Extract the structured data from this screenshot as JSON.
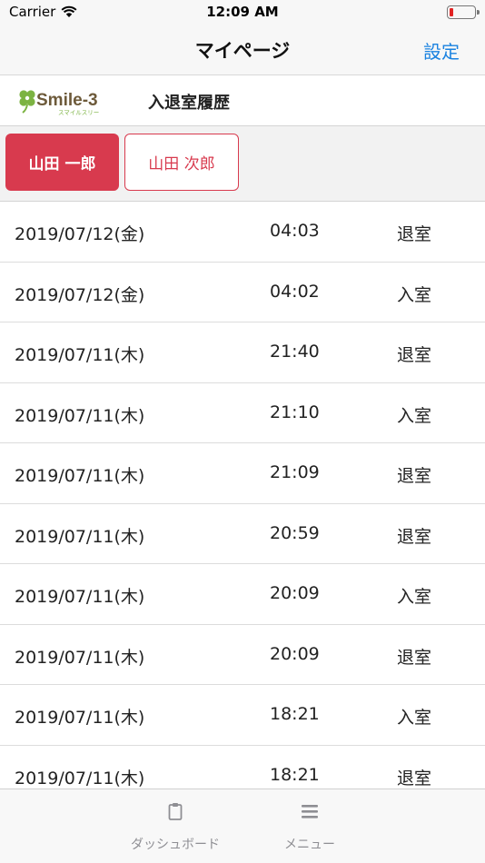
{
  "status_bar": {
    "carrier": "Carrier",
    "time": "12:09 AM",
    "battery_level": 0.15
  },
  "nav": {
    "title": "マイページ",
    "settings_label": "設定"
  },
  "section": {
    "logo_text": "Smile-3",
    "logo_subtext": "スマイルスリー",
    "title": "入退室履歴"
  },
  "tabs": [
    {
      "label": "山田 一郎",
      "active": true
    },
    {
      "label": "山田 次郎",
      "active": false
    }
  ],
  "records": [
    {
      "date": "2019/07/12(金)",
      "time": "04:03",
      "type": "退室"
    },
    {
      "date": "2019/07/12(金)",
      "time": "04:02",
      "type": "入室"
    },
    {
      "date": "2019/07/11(木)",
      "time": "21:40",
      "type": "退室"
    },
    {
      "date": "2019/07/11(木)",
      "time": "21:10",
      "type": "入室"
    },
    {
      "date": "2019/07/11(木)",
      "time": "21:09",
      "type": "退室"
    },
    {
      "date": "2019/07/11(木)",
      "time": "20:59",
      "type": "退室"
    },
    {
      "date": "2019/07/11(木)",
      "time": "20:09",
      "type": "入室"
    },
    {
      "date": "2019/07/11(木)",
      "time": "20:09",
      "type": "退室"
    },
    {
      "date": "2019/07/11(木)",
      "time": "18:21",
      "type": "入室"
    },
    {
      "date": "2019/07/11(木)",
      "time": "18:21",
      "type": "退室"
    }
  ],
  "tab_bar": {
    "items": [
      {
        "label": "ダッシュボード",
        "icon": "clipboard-icon"
      },
      {
        "label": "メニュー",
        "icon": "menu-icon"
      }
    ]
  },
  "colors": {
    "accent": "#d83a4e",
    "link": "#1a82e0",
    "battery_low": "#e22323",
    "logo_green": "#7cb342",
    "logo_brown": "#6d5a3a"
  }
}
